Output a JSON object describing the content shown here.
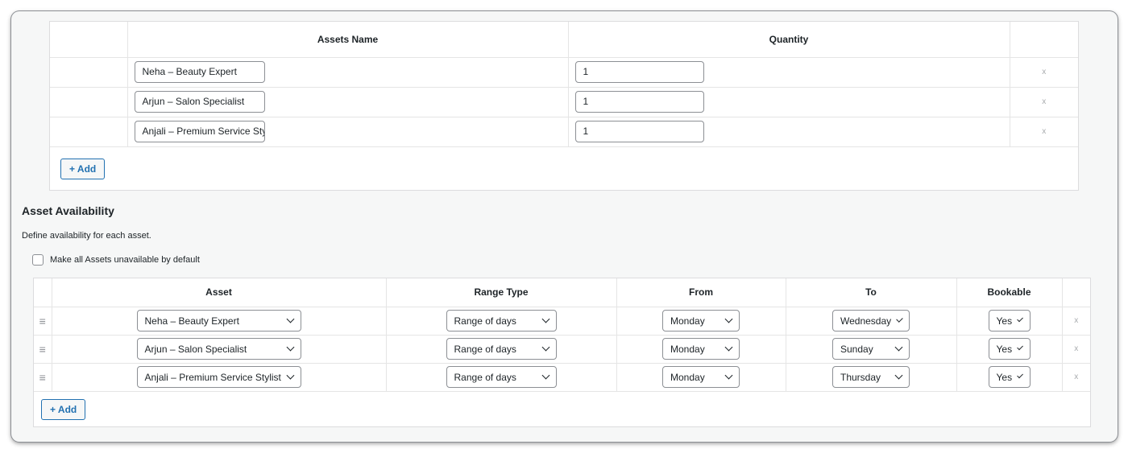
{
  "assets_table": {
    "headers": {
      "name": "Assets Name",
      "quantity": "Quantity"
    },
    "rows": [
      {
        "name": "Neha – Beauty Expert",
        "quantity": "1",
        "remove": "x"
      },
      {
        "name": "Arjun – Salon Specialist",
        "quantity": "1",
        "remove": "x"
      },
      {
        "name": "Anjali – Premium Service Stylist",
        "quantity": "1",
        "remove": "x"
      }
    ],
    "add_label": "+ Add"
  },
  "availability": {
    "title": "Asset Availability",
    "description": "Define availability for each asset.",
    "default_unavailable_label": "Make all Assets unavailable by default",
    "default_unavailable_checked": false,
    "headers": {
      "asset": "Asset",
      "range_type": "Range Type",
      "from": "From",
      "to": "To",
      "bookable": "Bookable"
    },
    "rows": [
      {
        "asset": "Neha – Beauty Expert",
        "range_type": "Range of days",
        "from": "Monday",
        "to": "Wednesday",
        "bookable": "Yes",
        "remove": "x"
      },
      {
        "asset": "Arjun – Salon Specialist",
        "range_type": "Range of days",
        "from": "Monday",
        "to": "Sunday",
        "bookable": "Yes",
        "remove": "x"
      },
      {
        "asset": "Anjali – Premium Service Stylist",
        "range_type": "Range of days",
        "from": "Monday",
        "to": "Thursday",
        "bookable": "Yes",
        "remove": "x"
      }
    ],
    "add_label": "+ Add",
    "icons": {
      "drag": "drag-handle-icon",
      "select": "chevron-down-icon"
    }
  }
}
